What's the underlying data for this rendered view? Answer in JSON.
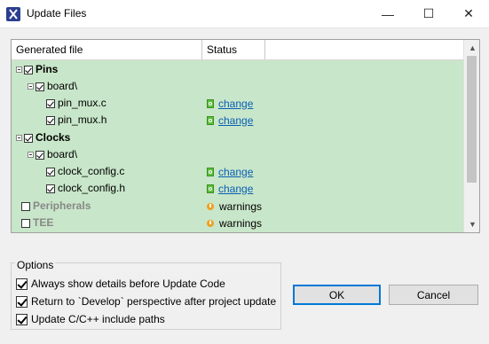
{
  "window": {
    "title": "Update Files",
    "minimize_glyph": "—",
    "maximize_glyph": "☐",
    "close_glyph": "✕"
  },
  "table": {
    "columns": [
      "Generated file",
      "Status"
    ],
    "rows": [
      {
        "label": "Pins",
        "status": ""
      },
      {
        "label": "board\\",
        "status": ""
      },
      {
        "label": "pin_mux.c",
        "status": "change"
      },
      {
        "label": "pin_mux.h",
        "status": "change"
      },
      {
        "label": "Clocks",
        "status": ""
      },
      {
        "label": "board\\",
        "status": ""
      },
      {
        "label": "clock_config.c",
        "status": "change"
      },
      {
        "label": "clock_config.h",
        "status": "change"
      },
      {
        "label": "Peripherals",
        "status": "warnings"
      },
      {
        "label": "TEE",
        "status": "warnings"
      }
    ]
  },
  "options": {
    "legend": "Options",
    "items": [
      {
        "label": "Always show details before Update Code",
        "checked": true
      },
      {
        "label": "Return to `Develop` perspective after project update",
        "checked": true
      },
      {
        "label": "Update C/C++ include paths",
        "checked": true
      }
    ]
  },
  "buttons": {
    "ok": "OK",
    "cancel": "Cancel"
  },
  "colors": {
    "row_background": "#c8e6c9",
    "link": "#0a5fb4",
    "accent": "#0078d7"
  }
}
